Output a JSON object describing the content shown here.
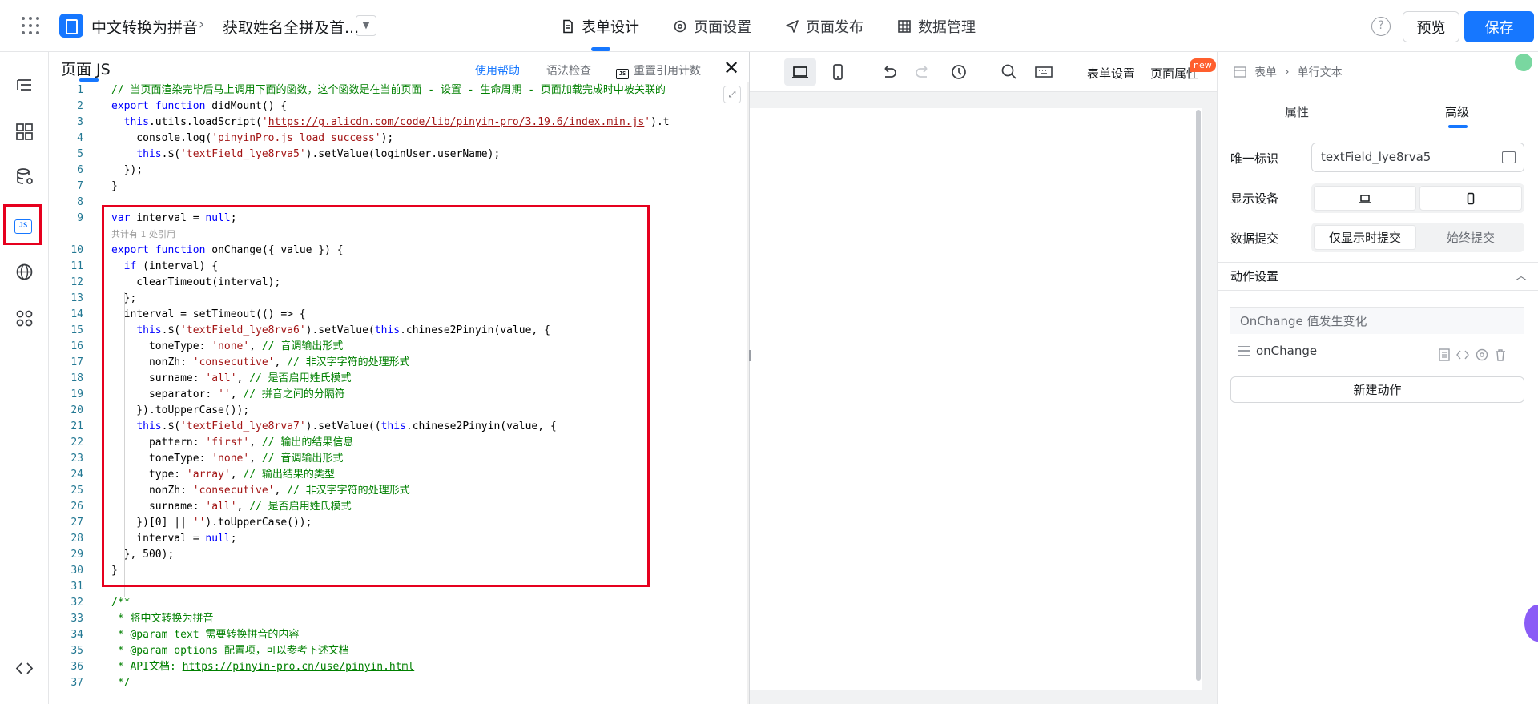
{
  "header": {
    "app_name": "中文转换为拼音",
    "page_name": "获取姓名全拼及首...",
    "nav": [
      {
        "label": "表单设计"
      },
      {
        "label": "页面设置"
      },
      {
        "label": "页面发布"
      },
      {
        "label": "数据管理"
      }
    ],
    "help": "?",
    "preview_label": "预览",
    "save_label": "保存"
  },
  "code_panel": {
    "title": "页面 JS",
    "use_help": "使用帮助",
    "lint": "语法检查",
    "reset_refs": "重置引用计数",
    "js_badge": "JS",
    "code_lens": "共计有 1 处引用",
    "lines": [
      {
        "n": "1",
        "text": "// 当页面渲染完毕后马上调用下面的函数，这个函数是在当前页面 - 设置 - 生命周期 - 页面加载完成时中被关联的"
      },
      {
        "n": "2",
        "text": "export function didMount() {"
      },
      {
        "n": "3",
        "text": "  this.utils.loadScript('https://g.alicdn.com/code/lib/pinyin-pro/3.19.6/index.min.js').t"
      },
      {
        "n": "4",
        "text": "    console.log('pinyinPro.js load success');"
      },
      {
        "n": "5",
        "text": "    this.$('textField_lye8rva5').setValue(loginUser.userName);"
      },
      {
        "n": "6",
        "text": "  });"
      },
      {
        "n": "7",
        "text": "}"
      },
      {
        "n": "8",
        "text": ""
      },
      {
        "n": "9",
        "text": "var interval = null;"
      },
      {
        "n": "10",
        "text": "export function onChange({ value }) {"
      },
      {
        "n": "11",
        "text": "  if (interval) {"
      },
      {
        "n": "12",
        "text": "    clearTimeout(interval);"
      },
      {
        "n": "13",
        "text": "  };"
      },
      {
        "n": "14",
        "text": "  interval = setTimeout(() => {"
      },
      {
        "n": "15",
        "text": "    this.$('textField_lye8rva6').setValue(this.chinese2Pinyin(value, {"
      },
      {
        "n": "16",
        "text": "      toneType: 'none', // 音调输出形式"
      },
      {
        "n": "17",
        "text": "      nonZh: 'consecutive', // 非汉字字符的处理形式"
      },
      {
        "n": "18",
        "text": "      surname: 'all', // 是否启用姓氏模式"
      },
      {
        "n": "19",
        "text": "      separator: '', // 拼音之间的分隔符"
      },
      {
        "n": "20",
        "text": "    }).toUpperCase());"
      },
      {
        "n": "21",
        "text": "    this.$('textField_lye8rva7').setValue((this.chinese2Pinyin(value, {"
      },
      {
        "n": "22",
        "text": "      pattern: 'first', // 输出的结果信息"
      },
      {
        "n": "23",
        "text": "      toneType: 'none', // 音调输出形式"
      },
      {
        "n": "24",
        "text": "      type: 'array', // 输出结果的类型"
      },
      {
        "n": "25",
        "text": "      nonZh: 'consecutive', // 非汉字字符的处理形式"
      },
      {
        "n": "26",
        "text": "      surname: 'all', // 是否启用姓氏模式"
      },
      {
        "n": "27",
        "text": "    })[0] || '').toUpperCase());"
      },
      {
        "n": "28",
        "text": "    interval = null;"
      },
      {
        "n": "29",
        "text": "  }, 500);"
      },
      {
        "n": "30",
        "text": "}"
      },
      {
        "n": "31",
        "text": ""
      },
      {
        "n": "32",
        "text": "/**"
      },
      {
        "n": "33",
        "text": " * 将中文转换为拼音"
      },
      {
        "n": "34",
        "text": " * @param text 需要转换拼音的内容"
      },
      {
        "n": "35",
        "text": " * @param options 配置项，可以参考下述文档"
      },
      {
        "n": "36",
        "text": " * API文档: https://pinyin-pro.cn/use/pinyin.html"
      },
      {
        "n": "37",
        "text": " */"
      }
    ]
  },
  "canvas_toolbar": {
    "form_settings": "表单设置",
    "page_props": "页面属性",
    "new_badge": "new"
  },
  "right_panel": {
    "breadcrumb": [
      "表单",
      "单行文本"
    ],
    "tabs": [
      "属性",
      "高级"
    ],
    "active_tab": "高级",
    "unique_id_label": "唯一标识",
    "unique_id_value": "textField_lye8rva5",
    "display_device_label": "显示设备",
    "data_submit_label": "数据提交",
    "data_submit_options": [
      "仅显示时提交",
      "始终提交"
    ],
    "action_section": "动作设置",
    "event_label": "OnChange 值发生变化",
    "action_name": "onChange",
    "new_action": "新建动作"
  },
  "colors": {
    "accent": "#1677ff",
    "highlight_box": "#e6001e",
    "new_badge": "#ff5f2e"
  },
  "icons": [
    "grid-apps-icon",
    "form-logo-icon",
    "chevron-right-icon",
    "chevron-down-icon",
    "document-icon",
    "gear-icon",
    "send-icon",
    "table-icon",
    "help-icon",
    "outline-icon",
    "components-icon",
    "datasource-icon",
    "js-icon",
    "globe-icon",
    "plugins-icon",
    "code-toggle-icon",
    "close-icon",
    "expand-icon",
    "desktop-icon",
    "mobile-icon",
    "undo-icon",
    "redo-icon",
    "history-icon",
    "search-icon",
    "keyboard-icon",
    "form-node-icon",
    "picker-icon",
    "drag-icon",
    "copy-icon",
    "code-icon",
    "settings-icon",
    "trash-icon"
  ]
}
